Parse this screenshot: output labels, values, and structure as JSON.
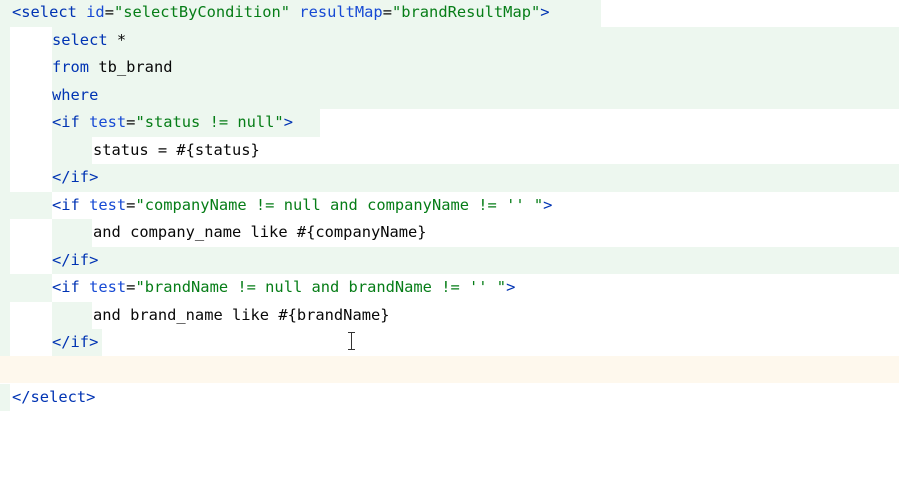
{
  "editor": {
    "lines": [
      {
        "parts": [
          {
            "t": "<select",
            "c": "tag"
          },
          {
            "t": " id",
            "c": "attr"
          },
          {
            "t": "=",
            "c": "plain"
          },
          {
            "t": "\"selectByCondition\"",
            "c": "str"
          },
          {
            "t": " resultMap",
            "c": "attr"
          },
          {
            "t": "=",
            "c": "plain"
          },
          {
            "t": "\"brandResultMap\"",
            "c": "str"
          },
          {
            "t": ">",
            "c": "tag"
          }
        ]
      },
      {
        "parts": [
          {
            "t": "select",
            "c": "tag"
          },
          {
            "t": " *",
            "c": "plain"
          }
        ]
      },
      {
        "parts": [
          {
            "t": "from",
            "c": "tag"
          },
          {
            "t": " tb_brand",
            "c": "plain"
          }
        ]
      },
      {
        "parts": [
          {
            "t": "where",
            "c": "tag"
          }
        ]
      },
      {
        "parts": [
          {
            "t": "<if",
            "c": "tag"
          },
          {
            "t": " test",
            "c": "attr"
          },
          {
            "t": "=",
            "c": "plain"
          },
          {
            "t": "\"status != null\"",
            "c": "str"
          },
          {
            "t": ">",
            "c": "tag"
          }
        ]
      },
      {
        "parts": [
          {
            "t": "status = #{status}",
            "c": "plain"
          }
        ]
      },
      {
        "parts": [
          {
            "t": "</if>",
            "c": "tag"
          }
        ]
      },
      {
        "parts": [
          {
            "t": "<if",
            "c": "tag"
          },
          {
            "t": " test",
            "c": "attr"
          },
          {
            "t": "=",
            "c": "plain"
          },
          {
            "t": "\"companyName != null and companyName != '' \"",
            "c": "str"
          },
          {
            "t": ">",
            "c": "tag"
          }
        ]
      },
      {
        "parts": [
          {
            "t": "and company_name like #{companyName}",
            "c": "plain"
          }
        ]
      },
      {
        "parts": [
          {
            "t": "</if>",
            "c": "tag"
          }
        ]
      },
      {
        "parts": [
          {
            "t": "<if",
            "c": "tag"
          },
          {
            "t": " test",
            "c": "attr"
          },
          {
            "t": "=",
            "c": "plain"
          },
          {
            "t": "\"brandName != null and brandName != '' \"",
            "c": "str"
          },
          {
            "t": ">",
            "c": "tag"
          }
        ]
      },
      {
        "parts": [
          {
            "t": "and brand_name like #{brandName}",
            "c": "plain"
          }
        ]
      },
      {
        "parts": [
          {
            "t": "</if>",
            "c": "tag"
          }
        ]
      },
      {
        "parts": []
      },
      {
        "parts": [
          {
            "t": "</select>",
            "c": "tag"
          }
        ]
      }
    ]
  },
  "colors": {
    "tag": "#0033b3",
    "attribute": "#174ad4",
    "string": "#067d17",
    "text": "#080808",
    "diff_added": "#edf7ef",
    "current_line": "#fef8ed"
  }
}
